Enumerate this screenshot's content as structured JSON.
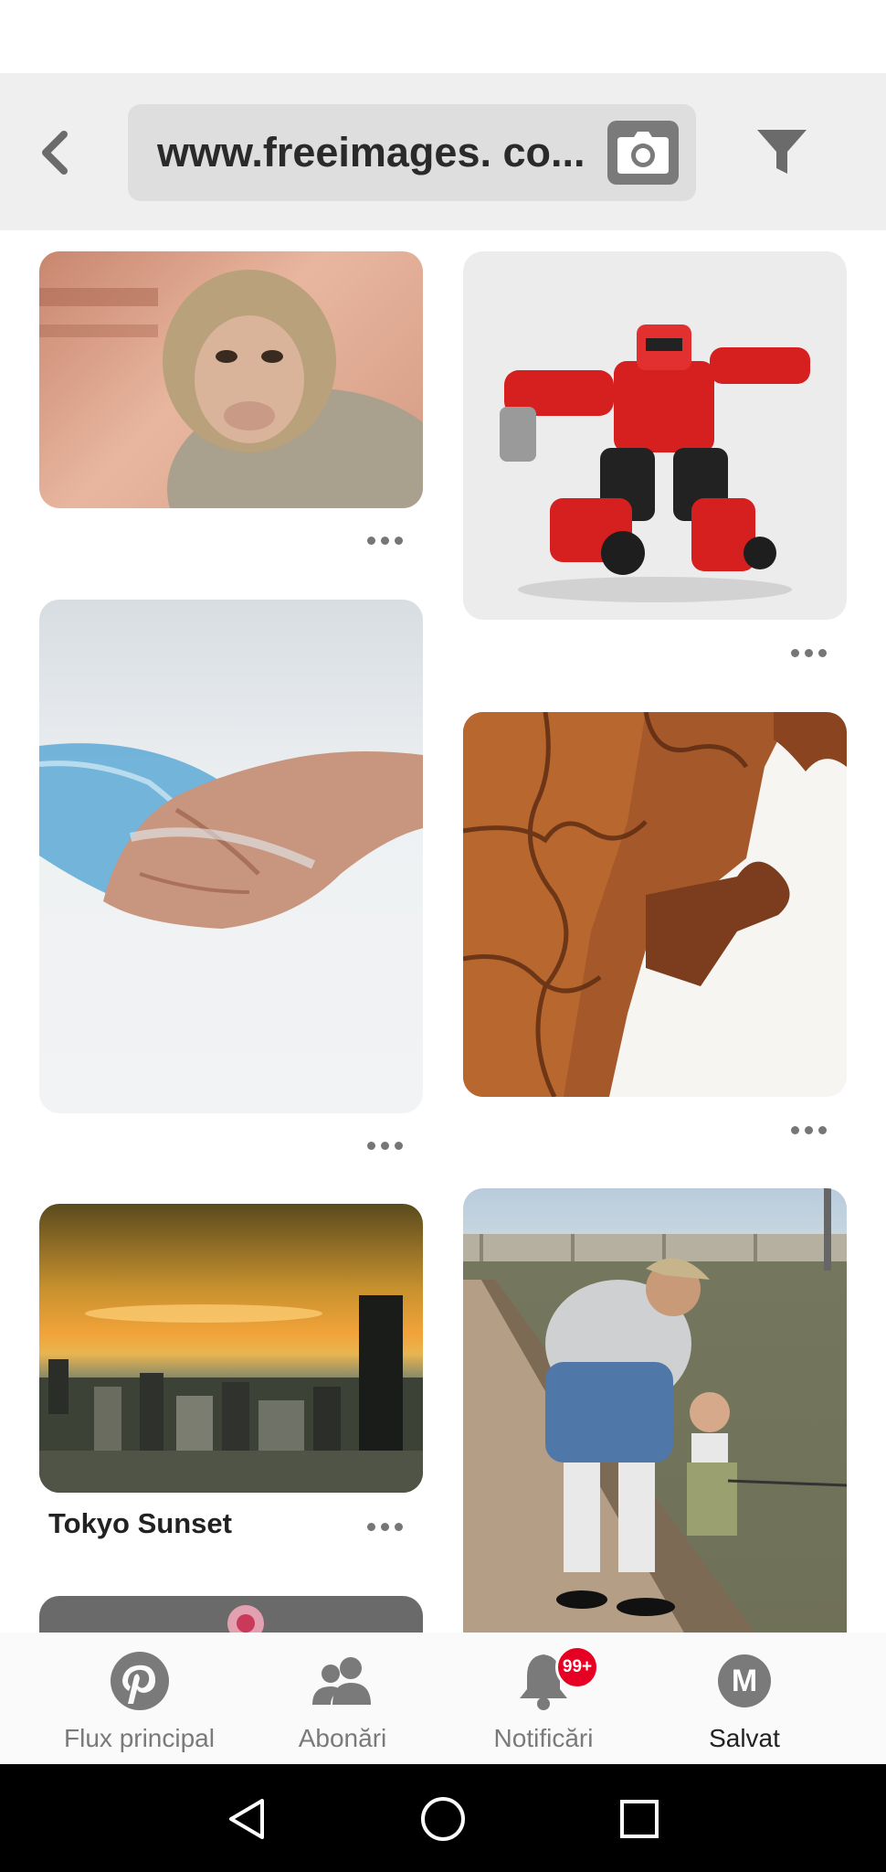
{
  "header": {
    "back_icon": "chevron-left-icon",
    "search_text": "www.freeimages. co...",
    "camera_icon": "camera-icon",
    "filter_icon": "filter-icon"
  },
  "pins": [
    {
      "id": "monkey",
      "subject": "monkey"
    },
    {
      "id": "robot",
      "subject": "red toy robot"
    },
    {
      "id": "hand",
      "subject": "hand with water"
    },
    {
      "id": "puzzle",
      "subject": "puzzle pieces"
    },
    {
      "id": "tokyo",
      "subject": "city sunset",
      "title": "Tokyo Sunset"
    },
    {
      "id": "fishing",
      "subject": "man and child fishing on pier"
    }
  ],
  "bottom_nav": {
    "items": [
      {
        "label": "Flux principal",
        "icon": "pinterest-logo-icon"
      },
      {
        "label": "Abonări",
        "icon": "people-icon"
      },
      {
        "label": "Notificări",
        "icon": "bell-icon",
        "badge": "99+"
      },
      {
        "label": "Salvat",
        "icon": "profile-avatar-icon",
        "avatar_letter": "M",
        "active": true
      }
    ]
  },
  "colors": {
    "accent": "#e60023",
    "header_bg": "#efefef",
    "search_bg": "#dedede",
    "icon_gray": "#767676"
  }
}
